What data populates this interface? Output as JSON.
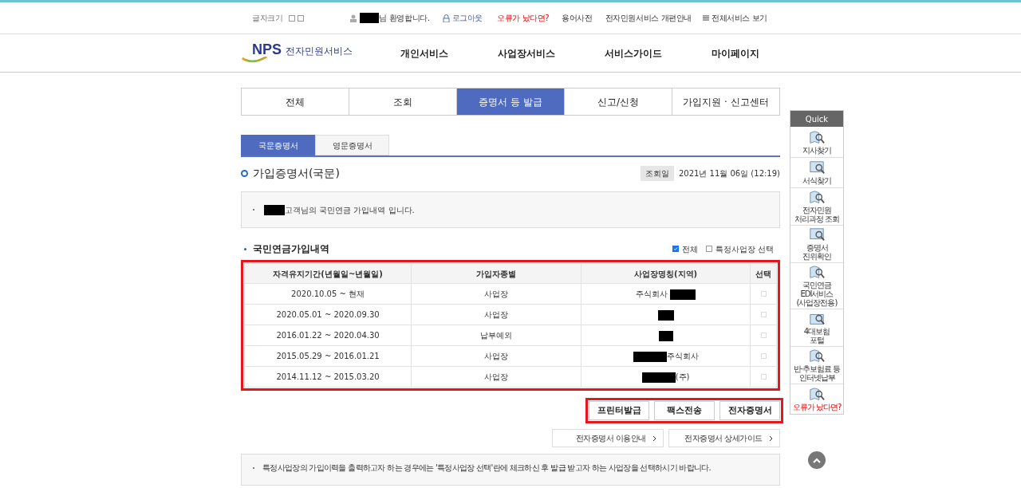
{
  "top_bar": {
    "font_size_label": "글자크기",
    "welcome": "님 환영합니다.",
    "logout": "로그아웃",
    "error_link": "오류가 났다면?",
    "links": [
      "용어사전",
      "전자민원서비스 개편안내"
    ],
    "all_services": "전체서비스 보기"
  },
  "logo": {
    "mark": "NPS",
    "text": "전자민원서비스"
  },
  "nav": [
    "개인서비스",
    "사업장서비스",
    "서비스가이드",
    "마이페이지"
  ],
  "main_tabs": [
    {
      "label": "전체",
      "selected": false
    },
    {
      "label": "조회",
      "selected": false
    },
    {
      "label": "증명서 등 발급",
      "selected": true
    },
    {
      "label": "신고/신청",
      "selected": false
    },
    {
      "label": "가입지원 · 신고센터",
      "selected": false
    }
  ],
  "sub_tabs": [
    {
      "label": "국문증명서",
      "selected": true
    },
    {
      "label": "영문증명서",
      "selected": false
    }
  ],
  "page_title": "가입증명서(국문)",
  "query_label": "조회일",
  "query_date": "2021년 11월 06일 (12:19)",
  "notice": "고객님의 국민연금 가입내역 입니다.",
  "section_title": "국민연금가입내역",
  "options": [
    {
      "label": "전체",
      "checked": true
    },
    {
      "label": "특정사업장 선택",
      "checked": false
    }
  ],
  "table": {
    "columns": [
      "자격유지기간(년월일~년월일)",
      "가입자종별",
      "사업장명칭(지역)",
      "선택"
    ],
    "rows": [
      {
        "period": "2020.10.05 ~ 현재",
        "type": "사업장",
        "name_before": "주식회사 ",
        "checked": false
      },
      {
        "period": "2020.05.01 ~ 2020.09.30",
        "type": "사업장",
        "checked": false
      },
      {
        "period": "2016.01.22 ~ 2020.04.30",
        "type": "납부예외",
        "checked": false
      },
      {
        "period": "2015.05.29 ~ 2016.01.21",
        "type": "사업장",
        "name_after": "주식회사",
        "checked": false
      },
      {
        "period": "2014.11.12 ~ 2015.03.20",
        "type": "사업장",
        "name_after": "(주)",
        "checked": false
      }
    ]
  },
  "actions": [
    "프린터발급",
    "팩스전송",
    "전자증명서"
  ],
  "guides": [
    "전자증명서 이용안내",
    "전자증명서 상세가이드"
  ],
  "notes": [
    "특정사업장의 가입이력을 출력하고자 하는 경우에는 '특정사업장 선택'란에 체크하신 후 발급 받고자 하는 사업장을 선택하시기 바랍니다."
  ],
  "quick": {
    "title": "Quick",
    "items": [
      {
        "kind": "link",
        "lines": [
          "지사찾기"
        ]
      },
      {
        "kind": "link",
        "lines": [
          "서식찾기"
        ]
      },
      {
        "kind": "link",
        "lines": [
          "전자민원",
          "처리과정 조회"
        ]
      },
      {
        "kind": "link",
        "lines": [
          "증명서",
          "진위확인"
        ]
      },
      {
        "kind": "link",
        "lines": [
          "국민연금",
          "EDI서비스",
          "(사업장전용)"
        ]
      },
      {
        "kind": "link",
        "lines": [
          "4대보험",
          "포털"
        ]
      },
      {
        "kind": "link",
        "lines": [
          "반·추보험료 등",
          "인터넷납부"
        ]
      },
      {
        "kind": "alert",
        "lines": [
          "오류가 났다면?"
        ]
      }
    ]
  }
}
